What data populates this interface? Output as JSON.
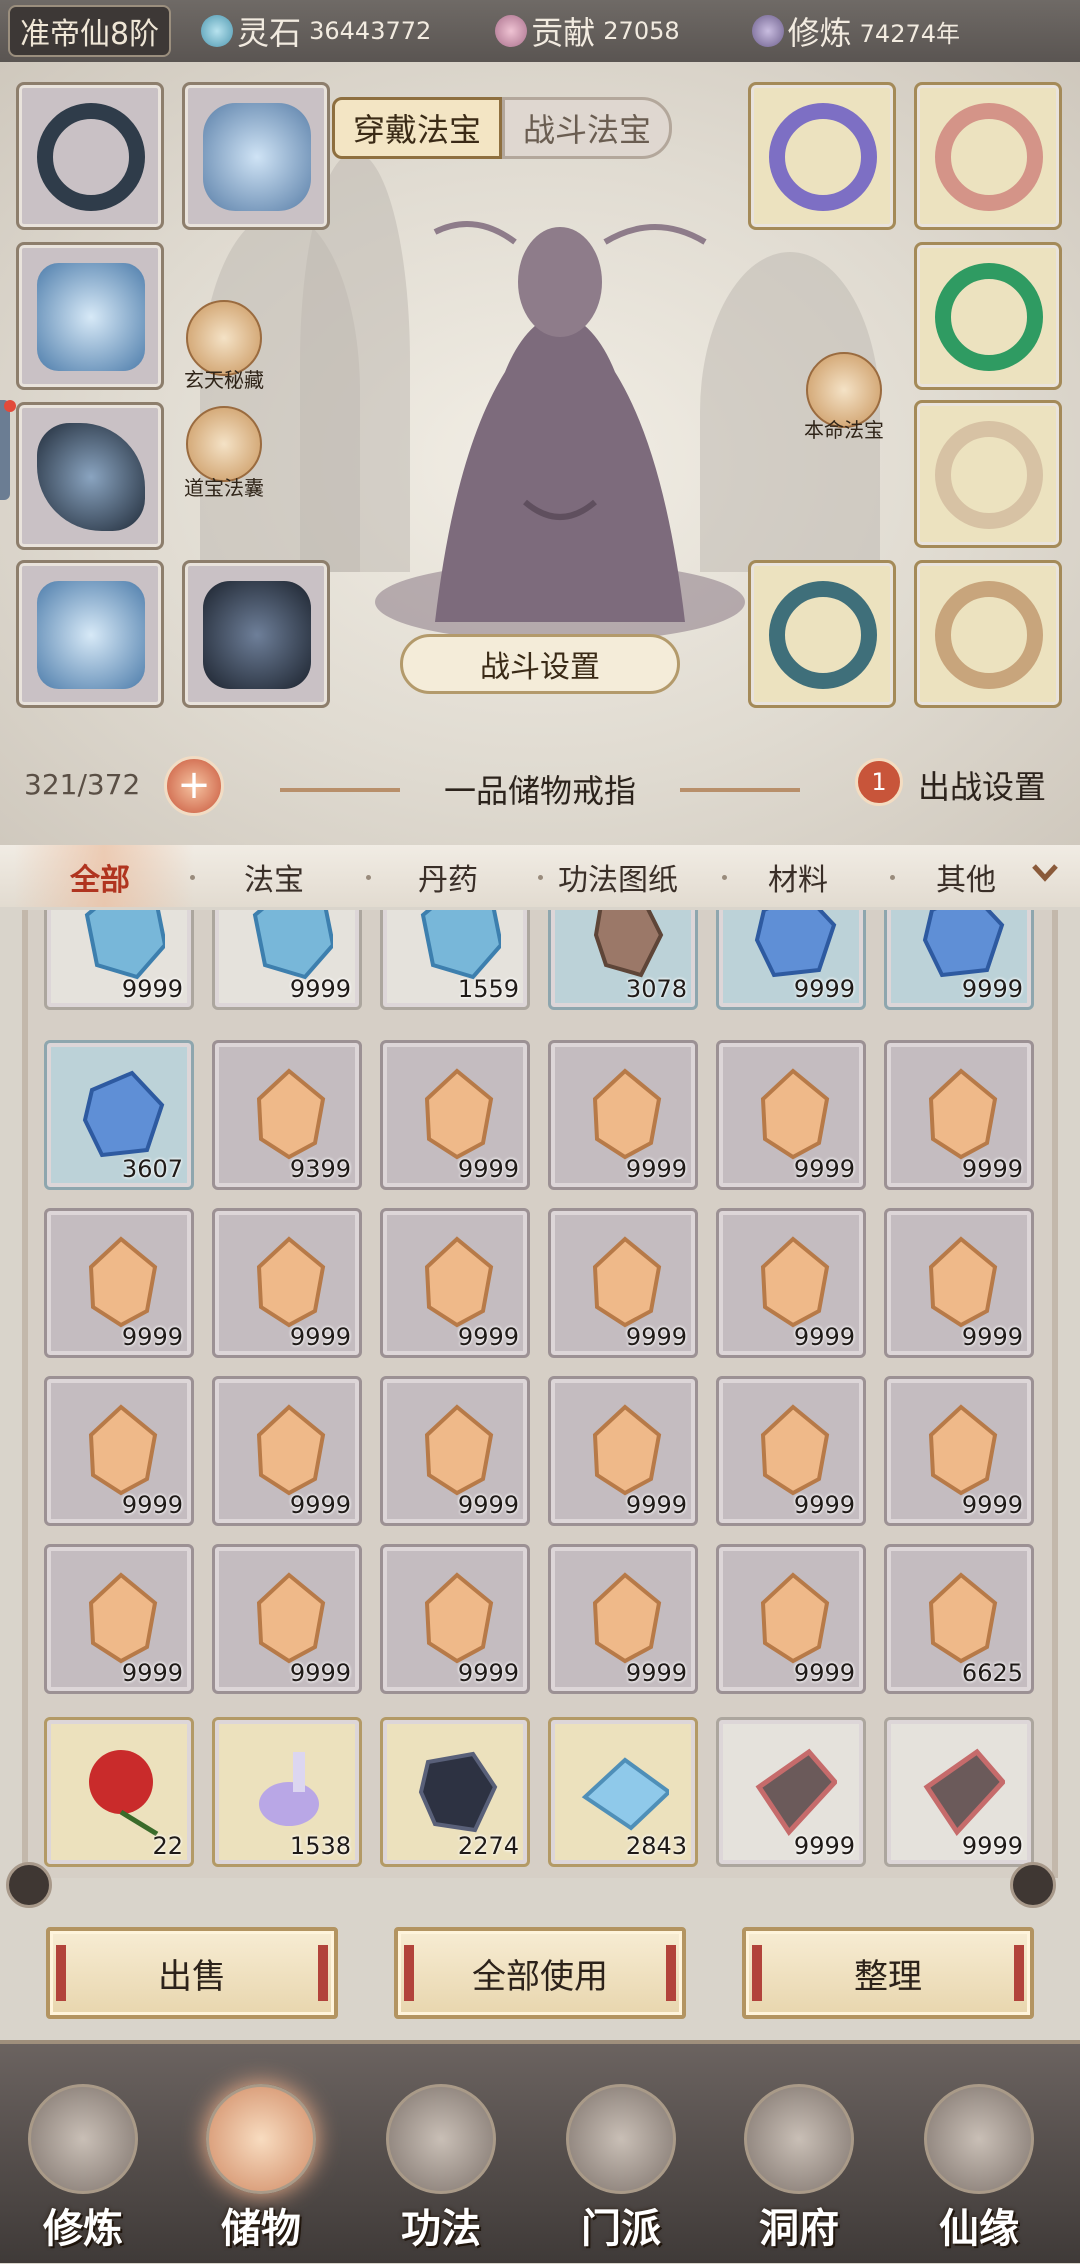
{
  "topbar": {
    "realm": "准帝仙8阶",
    "resources": [
      {
        "label": "灵石",
        "value": "36443772",
        "icon": "spirit-stone-icon",
        "color": "#6fb4c9"
      },
      {
        "label": "贡献",
        "value": "27058",
        "icon": "contribution-icon",
        "color": "#c98fa8"
      },
      {
        "label": "修炼",
        "value": "74274年",
        "icon": "cultivation-icon",
        "color": "#8d7fa8"
      }
    ]
  },
  "equip": {
    "tab_wear": "穿戴法宝",
    "tab_battle": "战斗法宝",
    "secret": "玄天秘藏",
    "pouch": "道宝法囊",
    "natal": "本命法宝",
    "fight_settings": "战斗设置"
  },
  "storage": {
    "count": "321/372",
    "ring_name": "一品储物戒指",
    "deploy_badge": "1",
    "deploy_label": "出战设置"
  },
  "categories": [
    "全部",
    "法宝",
    "丹药",
    "功法图纸",
    "材料",
    "其他"
  ],
  "items": [
    {
      "qty": "9999",
      "kind": "crystal",
      "bg": "white"
    },
    {
      "qty": "9999",
      "kind": "crystal",
      "bg": "white"
    },
    {
      "qty": "1559",
      "kind": "crystal",
      "bg": "white"
    },
    {
      "qty": "3078",
      "kind": "ore",
      "bg": "blue"
    },
    {
      "qty": "9999",
      "kind": "bluegem",
      "bg": "blue"
    },
    {
      "qty": "9999",
      "kind": "bluegem",
      "bg": "blue"
    },
    {
      "qty": "3607",
      "kind": "bluegem",
      "bg": "blue"
    },
    {
      "qty": "9399",
      "kind": "amber",
      "bg": "purple"
    },
    {
      "qty": "9999",
      "kind": "amber",
      "bg": "purple"
    },
    {
      "qty": "9999",
      "kind": "amber",
      "bg": "purple"
    },
    {
      "qty": "9999",
      "kind": "amber",
      "bg": "purple"
    },
    {
      "qty": "9999",
      "kind": "amber",
      "bg": "purple"
    },
    {
      "qty": "9999",
      "kind": "amber",
      "bg": "purple"
    },
    {
      "qty": "9999",
      "kind": "amber",
      "bg": "purple"
    },
    {
      "qty": "9999",
      "kind": "amber",
      "bg": "purple"
    },
    {
      "qty": "9999",
      "kind": "amber",
      "bg": "purple"
    },
    {
      "qty": "9999",
      "kind": "amber",
      "bg": "purple"
    },
    {
      "qty": "9999",
      "kind": "amber",
      "bg": "purple"
    },
    {
      "qty": "9999",
      "kind": "amber",
      "bg": "purple"
    },
    {
      "qty": "9999",
      "kind": "amber",
      "bg": "purple"
    },
    {
      "qty": "9999",
      "kind": "amber",
      "bg": "purple"
    },
    {
      "qty": "9999",
      "kind": "amber",
      "bg": "purple"
    },
    {
      "qty": "9999",
      "kind": "amber",
      "bg": "purple"
    },
    {
      "qty": "9999",
      "kind": "amber",
      "bg": "purple"
    },
    {
      "qty": "9999",
      "kind": "amber",
      "bg": "purple"
    },
    {
      "qty": "9999",
      "kind": "amber",
      "bg": "purple"
    },
    {
      "qty": "9999",
      "kind": "amber",
      "bg": "purple"
    },
    {
      "qty": "9999",
      "kind": "amber",
      "bg": "purple"
    },
    {
      "qty": "9999",
      "kind": "amber",
      "bg": "purple"
    },
    {
      "qty": "6625",
      "kind": "amber",
      "bg": "purple"
    },
    {
      "qty": "22",
      "kind": "flower",
      "bg": "gold"
    },
    {
      "qty": "1538",
      "kind": "bottle",
      "bg": "gold"
    },
    {
      "qty": "2274",
      "kind": "blackore",
      "bg": "gold"
    },
    {
      "qty": "2843",
      "kind": "icemap",
      "bg": "gold"
    },
    {
      "qty": "9999",
      "kind": "redstone",
      "bg": "white"
    },
    {
      "qty": "9999",
      "kind": "redstone",
      "bg": "white"
    }
  ],
  "actions": {
    "sell": "出售",
    "use_all": "全部使用",
    "sort": "整理"
  },
  "nav": [
    "修炼",
    "储物",
    "功法",
    "门派",
    "洞府",
    "仙缘"
  ]
}
